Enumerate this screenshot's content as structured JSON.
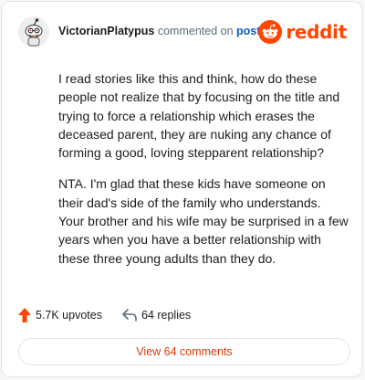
{
  "header": {
    "username": "VictorianPlatypus",
    "action_text": "commented on",
    "post_link": "post",
    "brand": "reddit",
    "brand_color": "#ff4500"
  },
  "icons": {
    "avatar": "snoo-avatar-icon",
    "logo": "reddit-snoo-icon",
    "upvote": "upvote-arrow-icon",
    "reply": "reply-arrow-icon"
  },
  "comment": {
    "paragraphs": [
      "I read stories like this and think, how do these people not realize that by focusing on the title and trying to force a relationship which erases the deceased parent, they are nuking any chance of forming a good, loving stepparent relationship?",
      "NTA. I'm glad that these kids have someone on their dad's side of the family who understands. Your brother and his wife may be surprised in a few years when you have a better relationship with these three young adults than they do."
    ]
  },
  "stats": {
    "upvotes": "5.7K upvotes",
    "replies": "64 replies"
  },
  "footer": {
    "view_comments": "View 64 comments",
    "accent_color": "#d93a00"
  }
}
